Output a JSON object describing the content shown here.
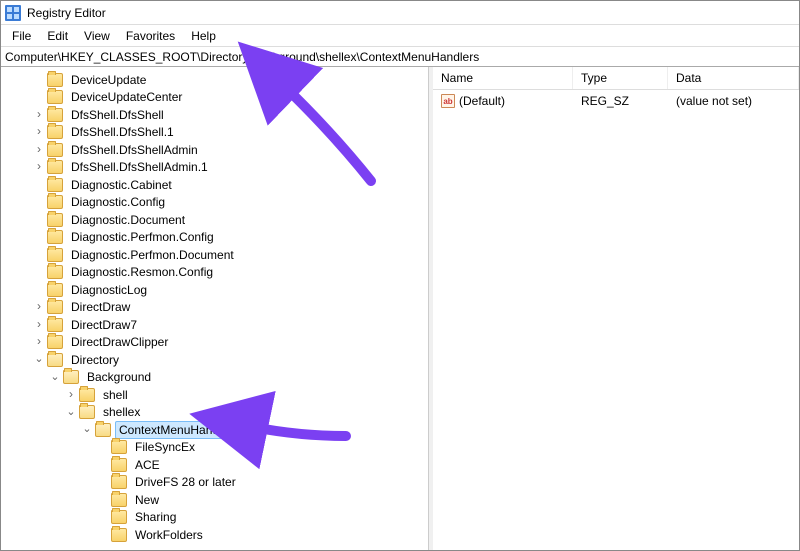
{
  "window": {
    "title": "Registry Editor"
  },
  "menu": {
    "file": "File",
    "edit": "Edit",
    "view": "View",
    "favorites": "Favorites",
    "help": "Help"
  },
  "address": {
    "path": "Computer\\HKEY_CLASSES_ROOT\\Directory\\Background\\shellex\\ContextMenuHandlers"
  },
  "tree": {
    "items": [
      {
        "indent": 2,
        "exp": "none",
        "label": "DeviceUpdate"
      },
      {
        "indent": 2,
        "exp": "none",
        "label": "DeviceUpdateCenter"
      },
      {
        "indent": 2,
        "exp": "closed",
        "label": "DfsShell.DfsShell"
      },
      {
        "indent": 2,
        "exp": "closed",
        "label": "DfsShell.DfsShell.1"
      },
      {
        "indent": 2,
        "exp": "closed",
        "label": "DfsShell.DfsShellAdmin"
      },
      {
        "indent": 2,
        "exp": "closed",
        "label": "DfsShell.DfsShellAdmin.1"
      },
      {
        "indent": 2,
        "exp": "none",
        "label": "Diagnostic.Cabinet"
      },
      {
        "indent": 2,
        "exp": "none",
        "label": "Diagnostic.Config"
      },
      {
        "indent": 2,
        "exp": "none",
        "label": "Diagnostic.Document"
      },
      {
        "indent": 2,
        "exp": "none",
        "label": "Diagnostic.Perfmon.Config"
      },
      {
        "indent": 2,
        "exp": "none",
        "label": "Diagnostic.Perfmon.Document"
      },
      {
        "indent": 2,
        "exp": "none",
        "label": "Diagnostic.Resmon.Config"
      },
      {
        "indent": 2,
        "exp": "none",
        "label": "DiagnosticLog"
      },
      {
        "indent": 2,
        "exp": "closed",
        "label": "DirectDraw"
      },
      {
        "indent": 2,
        "exp": "closed",
        "label": "DirectDraw7"
      },
      {
        "indent": 2,
        "exp": "closed",
        "label": "DirectDrawClipper"
      },
      {
        "indent": 2,
        "exp": "open",
        "label": "Directory",
        "open": true
      },
      {
        "indent": 3,
        "exp": "open",
        "label": "Background",
        "open": true
      },
      {
        "indent": 4,
        "exp": "closed",
        "label": "shell"
      },
      {
        "indent": 4,
        "exp": "open",
        "label": "shellex",
        "open": true
      },
      {
        "indent": 5,
        "exp": "open",
        "label": "ContextMenuHandlers",
        "open": true,
        "selected": true
      },
      {
        "indent": 6,
        "exp": "none",
        "label": " FileSyncEx"
      },
      {
        "indent": 6,
        "exp": "none",
        "label": "ACE"
      },
      {
        "indent": 6,
        "exp": "none",
        "label": "DriveFS 28 or later"
      },
      {
        "indent": 6,
        "exp": "none",
        "label": "New"
      },
      {
        "indent": 6,
        "exp": "none",
        "label": "Sharing"
      },
      {
        "indent": 6,
        "exp": "none",
        "label": "WorkFolders"
      }
    ]
  },
  "list": {
    "columns": {
      "name": "Name",
      "type": "Type",
      "data": "Data"
    },
    "rows": [
      {
        "icon": "ab",
        "name": "(Default)",
        "type": "REG_SZ",
        "data": "(value not set)"
      }
    ]
  }
}
